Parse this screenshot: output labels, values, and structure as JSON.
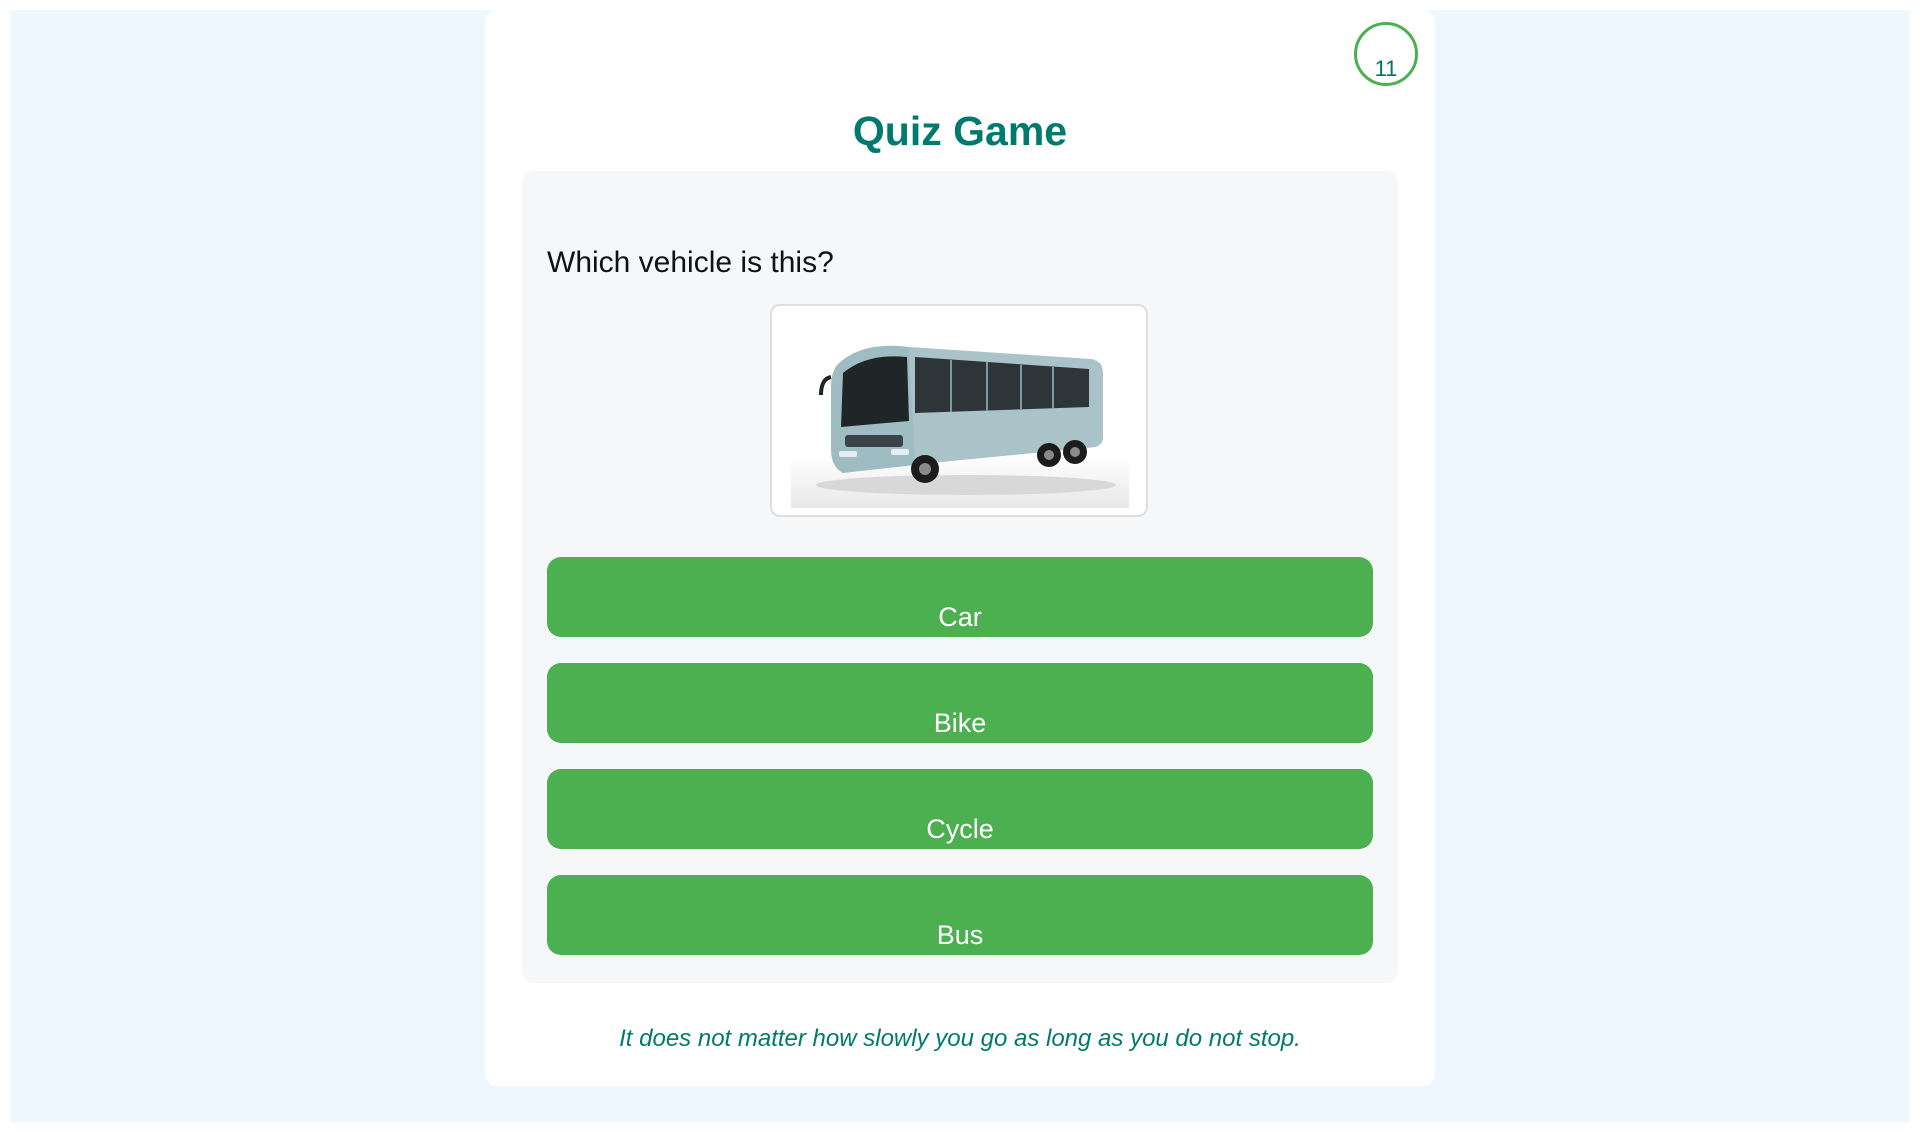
{
  "timer": {
    "value": "11"
  },
  "title": "Quiz Game",
  "question": {
    "text": "Which vehicle is this?",
    "image": {
      "subject": "bus",
      "icon": "bus-image"
    }
  },
  "answers": [
    {
      "label": "Car"
    },
    {
      "label": "Bike"
    },
    {
      "label": "Cycle"
    },
    {
      "label": "Bus"
    }
  ],
  "quote": "It does not matter how slowly you go as long as you do not stop.",
  "colors": {
    "background": "#eef6ff",
    "accent": "#4caf50",
    "title": "#007a6c",
    "panel": "#f6f7f9"
  }
}
